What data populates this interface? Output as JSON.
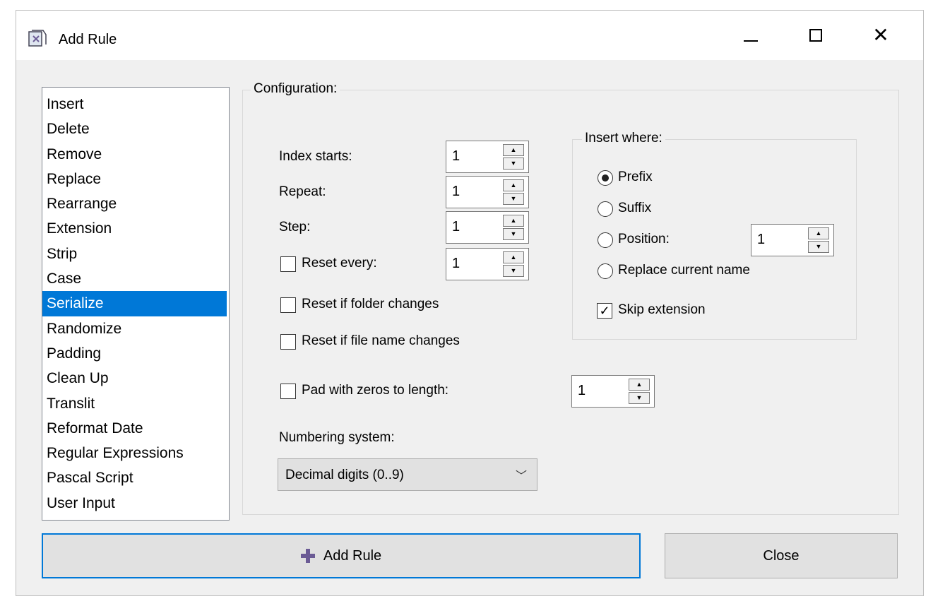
{
  "window": {
    "title": "Add Rule",
    "controls": [
      "minimize",
      "maximize",
      "close"
    ]
  },
  "rules_list": {
    "items": [
      "Insert",
      "Delete",
      "Remove",
      "Replace",
      "Rearrange",
      "Extension",
      "Strip",
      "Case",
      "Serialize",
      "Randomize",
      "Padding",
      "Clean Up",
      "Translit",
      "Reformat Date",
      "Regular Expressions",
      "Pascal Script",
      "User Input"
    ],
    "selected": "Serialize"
  },
  "config": {
    "group_label": "Configuration:",
    "index_starts": {
      "label": "Index starts:",
      "value": "1"
    },
    "repeat": {
      "label": "Repeat:",
      "value": "1"
    },
    "step": {
      "label": "Step:",
      "value": "1"
    },
    "reset_every": {
      "label": "Reset every:",
      "value": "1",
      "checked": false
    },
    "reset_folder": {
      "label": "Reset if folder changes",
      "checked": false
    },
    "reset_filename": {
      "label": "Reset if file name changes",
      "checked": false
    },
    "pad_zeros": {
      "label": "Pad with zeros to length:",
      "value": "1",
      "checked": false
    },
    "numbering": {
      "label": "Numbering system:",
      "value": "Decimal digits (0..9)"
    }
  },
  "insert_where": {
    "group_label": "Insert where:",
    "prefix": "Prefix",
    "suffix": "Suffix",
    "position": {
      "label": "Position:",
      "value": "1"
    },
    "replace_current": "Replace current name",
    "selected": "Prefix",
    "skip_extension": {
      "label": "Skip extension",
      "checked": true
    }
  },
  "buttons": {
    "add_rule": "Add Rule",
    "close": "Close"
  },
  "icons": {
    "spin_up": "▲",
    "spin_down": "▼",
    "chevron": "﹀",
    "check": "✓"
  },
  "colors": {
    "accent": "#0078d7",
    "window_bg": "#f0f0f0"
  }
}
